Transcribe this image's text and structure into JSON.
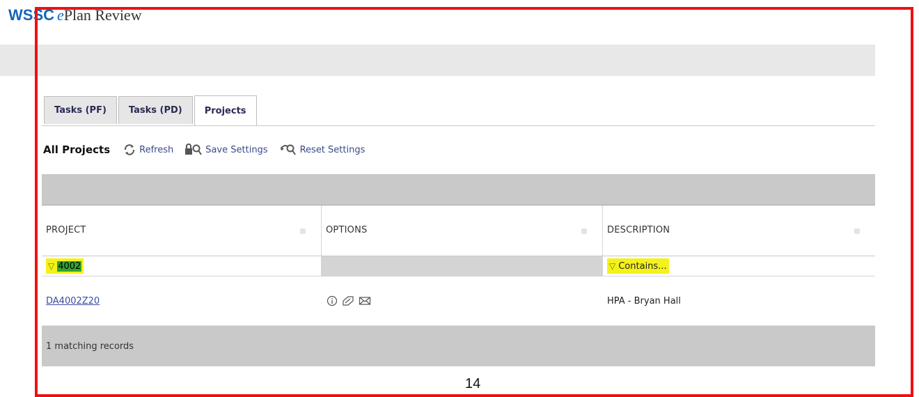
{
  "app": {
    "logo_wssc": "WSSC",
    "logo_e": "e",
    "logo_rest": "Plan Review"
  },
  "tabs": [
    {
      "label": "Tasks (PF)"
    },
    {
      "label": "Tasks (PD)"
    },
    {
      "label": "Projects"
    }
  ],
  "toolbar": {
    "title": "All Projects",
    "refresh_label": "Refresh",
    "save_label": "Save Settings",
    "reset_label": "Reset Settings"
  },
  "grid": {
    "columns": [
      {
        "header": "PROJECT"
      },
      {
        "header": "OPTIONS"
      },
      {
        "header": "DESCRIPTION"
      }
    ],
    "filters": {
      "project": "4002",
      "description_placeholder": "Contains..."
    },
    "rows": [
      {
        "project": "DA4002Z20",
        "description": "HPA - Bryan Hall"
      }
    ],
    "footer": "1 matching records"
  },
  "page_number": "14",
  "colors": {
    "accent": "#1766b8",
    "highlight": "#f4f21a",
    "annotation_frame": "#ee1111"
  }
}
